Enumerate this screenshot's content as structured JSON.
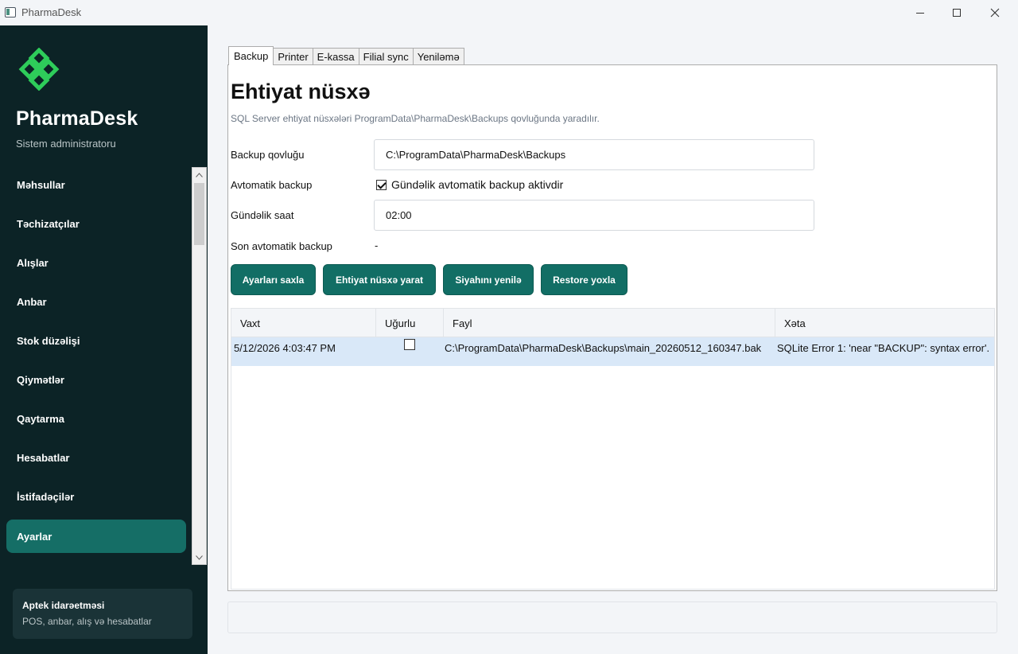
{
  "window": {
    "title": "PharmaDesk"
  },
  "sidebar": {
    "brand": "PharmaDesk",
    "role": "Sistem administratoru",
    "items": [
      {
        "label": "Məhsullar"
      },
      {
        "label": "Təchizatçılar"
      },
      {
        "label": "Alışlar"
      },
      {
        "label": "Anbar"
      },
      {
        "label": "Stok düzəlişi"
      },
      {
        "label": "Qiymətlər"
      },
      {
        "label": "Qaytarma"
      },
      {
        "label": "Hesabatlar"
      },
      {
        "label": "İstifadəçilər"
      },
      {
        "label": "Ayarlar"
      }
    ],
    "active_item": "Ayarlar",
    "card": {
      "title": "Aptek idarəetməsi",
      "subtitle": "POS, anbar, alış və hesabatlar"
    }
  },
  "tabs": [
    "Backup",
    "Printer",
    "E-kassa",
    "Filial sync",
    "Yeniləmə"
  ],
  "active_tab": "Backup",
  "backup": {
    "title": "Ehtiyat nüsxə",
    "subtitle": "SQL Server ehtiyat nüsxələri ProgramData\\PharmaDesk\\Backups qovluğunda yaradılır.",
    "folder_label": "Backup qovluğu",
    "folder_value": "C:\\ProgramData\\PharmaDesk\\Backups",
    "auto_label": "Avtomatik backup",
    "auto_checkbox_label": "Gündəlik avtomatik backup aktivdir",
    "auto_checked": true,
    "time_label": "Gündəlik saat",
    "time_value": "02:00",
    "last_label": "Son avtomatik backup",
    "last_value": "-",
    "buttons": {
      "save": "Ayarları saxla",
      "create": "Ehtiyat nüsxə yarat",
      "refresh": "Siyahını yenilə",
      "restore": "Restore yoxla"
    },
    "grid": {
      "columns": [
        "Vaxt",
        "Uğurlu",
        "Fayl",
        "Xəta"
      ],
      "rows": [
        {
          "time": "5/12/2026 4:03:47 PM",
          "success": false,
          "file": "C:\\ProgramData\\PharmaDesk\\Backups\\main_20260512_160347.bak",
          "error": "SQLite Error 1: 'near \"BACKUP\": syntax error'."
        }
      ]
    }
  },
  "colors": {
    "sidebar_bg": "#0c2326",
    "accent": "#126e65",
    "logo_green": "#2ecc5a",
    "selected_row": "#d9e8f8"
  }
}
